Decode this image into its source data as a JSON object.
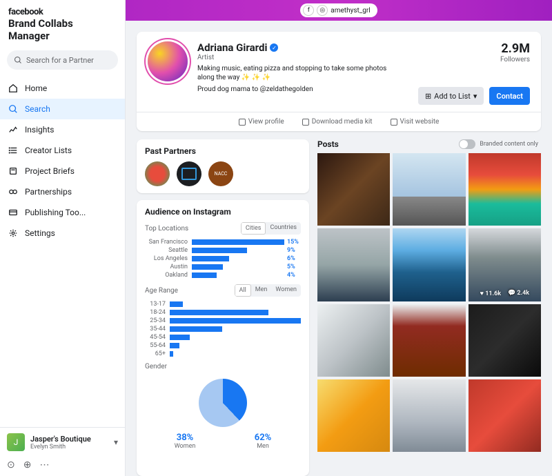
{
  "brand": {
    "fb": "facebook",
    "title": "Brand Collabs Manager"
  },
  "search": {
    "placeholder": "Search for a Partner"
  },
  "nav": [
    {
      "label": "Home"
    },
    {
      "label": "Search"
    },
    {
      "label": "Insights"
    },
    {
      "label": "Creator Lists"
    },
    {
      "label": "Project Briefs"
    },
    {
      "label": "Partnerships"
    },
    {
      "label": "Publishing Too..."
    },
    {
      "label": "Settings"
    }
  ],
  "account": {
    "business": "Jasper's Boutique",
    "user": "Evelyn Smith"
  },
  "topbar": {
    "handle": "amethyst_grl"
  },
  "profile": {
    "name": "Adriana Girardi",
    "role": "Artist",
    "bio1": "Making music, eating pizza and stopping to take some photos along the way ✨ ✨ ✨",
    "bio2": "Proud dog mama to @zeldathegolden",
    "followers": "2.9M",
    "followers_label": "Followers",
    "add_to_list": "Add to List",
    "contact": "Contact"
  },
  "profile_tabs": {
    "view": "View profile",
    "download": "Download media kit",
    "visit": "Visit website"
  },
  "past_partners": {
    "title": "Past Partners"
  },
  "audience": {
    "title": "Audience on Instagram",
    "top_locations_label": "Top Locations",
    "cities": "Cities",
    "countries": "Countries",
    "age_label": "Age Range",
    "all": "All",
    "men": "Men",
    "women": "Women",
    "gender_label": "Gender",
    "women_pct": "38%",
    "women_lbl": "Women",
    "men_pct": "62%",
    "men_lbl": "Men"
  },
  "posts": {
    "title": "Posts",
    "branded_label": "Branded content only",
    "likes": "11.6k",
    "comments": "2.4k"
  },
  "chart_data": {
    "top_locations": {
      "type": "bar",
      "orientation": "horizontal",
      "categories": [
        "San Francisco",
        "Seattle",
        "Los Angeles",
        "Austin",
        "Oakland"
      ],
      "values": [
        15,
        9,
        6,
        5,
        4
      ],
      "unit": "%",
      "toggle": [
        "Cities",
        "Countries"
      ],
      "selected_toggle": "Cities"
    },
    "age_range": {
      "type": "bar",
      "orientation": "horizontal",
      "categories": [
        "13-17",
        "18-24",
        "25-34",
        "35-44",
        "45-54",
        "55-64",
        "65+"
      ],
      "values": [
        4,
        30,
        40,
        16,
        6,
        3,
        1
      ],
      "unit": "%",
      "toggle": [
        "All",
        "Men",
        "Women"
      ],
      "selected_toggle": "All"
    },
    "gender": {
      "type": "pie",
      "series": [
        {
          "name": "Women",
          "value": 38
        },
        {
          "name": "Men",
          "value": 62
        }
      ],
      "unit": "%"
    }
  }
}
